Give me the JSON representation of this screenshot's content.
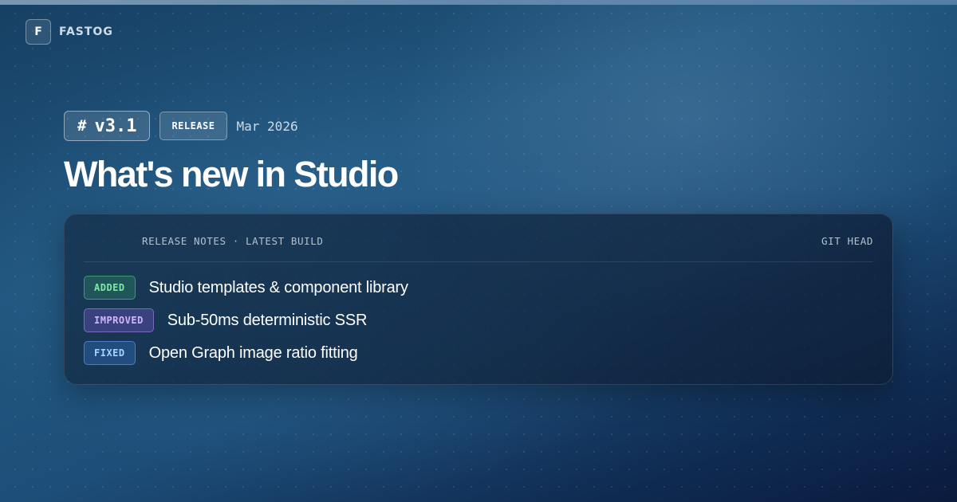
{
  "brand": {
    "logo_letter": "F",
    "name": "FASTOG"
  },
  "release": {
    "version": "v3.1",
    "version_icon": "#",
    "tag": "RELEASE",
    "date": "Mar 2026"
  },
  "headline": "What's new in Studio",
  "card": {
    "title": "RELEASE NOTES · LATEST BUILD",
    "ref": "GIT HEAD",
    "changes": [
      {
        "type": "ADDED",
        "text": "Studio templates & component library",
        "color": "#7ee8a8"
      },
      {
        "type": "IMPROVED",
        "text": "Sub-50ms deterministic SSR",
        "color": "#cfb6ff"
      },
      {
        "type": "FIXED",
        "text": "Open Graph image ratio fitting",
        "color": "#a8d2ff"
      }
    ]
  },
  "colors": {
    "background": "#1d4e79",
    "headline": "#ffffff",
    "muted": "#b3c2d0"
  }
}
